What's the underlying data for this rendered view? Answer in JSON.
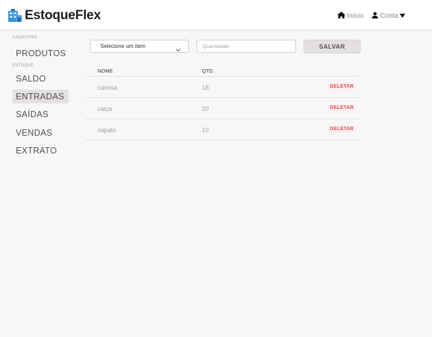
{
  "header": {
    "brand": "EstoqueFlex",
    "nav": [
      {
        "label": "Início",
        "icon": "home-icon"
      },
      {
        "label": "Conta",
        "icon": "user-icon"
      }
    ]
  },
  "sidebar": {
    "sections": [
      {
        "label": "CADASTRO",
        "items": [
          {
            "label": "PRODUTOS"
          }
        ]
      },
      {
        "label": "ESTOQUE",
        "items": [
          {
            "label": "SALDO"
          },
          {
            "label": "ENTRADAS",
            "active": true
          },
          {
            "label": "SAÍDAS"
          },
          {
            "label": "VENDAS"
          },
          {
            "label": "EXTRATO"
          }
        ]
      }
    ]
  },
  "form": {
    "select_label": "Selecione um item",
    "quantity_placeholder": "Quantidade",
    "save_label": "SALVAR"
  },
  "table": {
    "columns": [
      "NOME",
      "QTD."
    ],
    "rows": [
      {
        "name": "camisa",
        "qty": "18",
        "action": "DELETAR"
      },
      {
        "name": "calça",
        "qty": "20",
        "action": "DELETAR"
      },
      {
        "name": "sapato",
        "qty": "10",
        "action": "DELETAR"
      }
    ]
  },
  "colors": {
    "accent": "#3b8fd9",
    "delete": "#e05050",
    "active_bg": "#e4e0e0"
  }
}
